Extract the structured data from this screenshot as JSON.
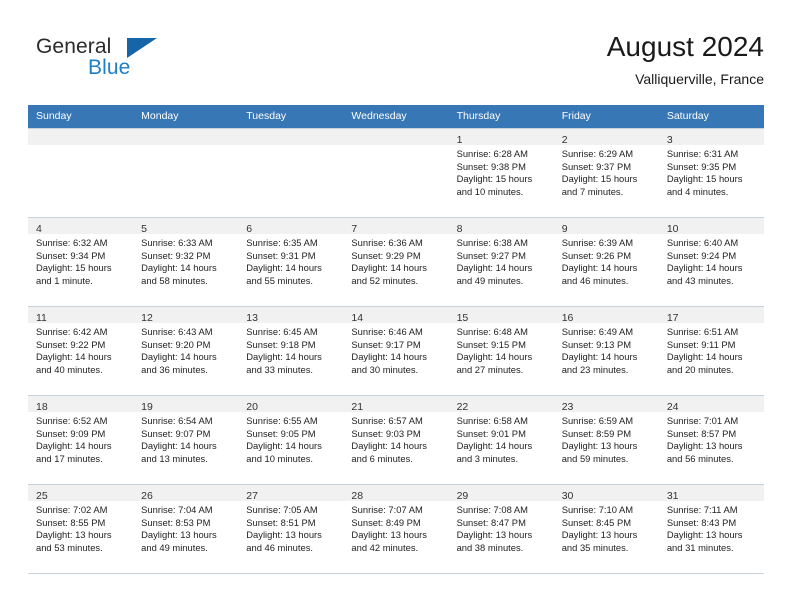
{
  "brand": {
    "word_one": "General",
    "word_two": "Blue",
    "triangle_color": "#1565a8",
    "blue_color": "#1f7fc4"
  },
  "header": {
    "title": "August 2024",
    "subtitle": "Valliquerville, France"
  },
  "theme": {
    "header_row_bg": "#3877b5",
    "daynum_band_bg": "#f1f1f1",
    "grid_line": "#c8d2dc"
  },
  "weekday_headers": [
    "Sunday",
    "Monday",
    "Tuesday",
    "Wednesday",
    "Thursday",
    "Friday",
    "Saturday"
  ],
  "weeks": [
    [
      {
        "day": "",
        "sunrise": "",
        "sunset": "",
        "daylight_1": "",
        "daylight_2": "",
        "empty": true
      },
      {
        "day": "",
        "sunrise": "",
        "sunset": "",
        "daylight_1": "",
        "daylight_2": "",
        "empty": true
      },
      {
        "day": "",
        "sunrise": "",
        "sunset": "",
        "daylight_1": "",
        "daylight_2": "",
        "empty": true
      },
      {
        "day": "",
        "sunrise": "",
        "sunset": "",
        "daylight_1": "",
        "daylight_2": "",
        "empty": true
      },
      {
        "day": "1",
        "sunrise": "Sunrise: 6:28 AM",
        "sunset": "Sunset: 9:38 PM",
        "daylight_1": "Daylight: 15 hours",
        "daylight_2": "and 10 minutes."
      },
      {
        "day": "2",
        "sunrise": "Sunrise: 6:29 AM",
        "sunset": "Sunset: 9:37 PM",
        "daylight_1": "Daylight: 15 hours",
        "daylight_2": "and 7 minutes."
      },
      {
        "day": "3",
        "sunrise": "Sunrise: 6:31 AM",
        "sunset": "Sunset: 9:35 PM",
        "daylight_1": "Daylight: 15 hours",
        "daylight_2": "and 4 minutes."
      }
    ],
    [
      {
        "day": "4",
        "sunrise": "Sunrise: 6:32 AM",
        "sunset": "Sunset: 9:34 PM",
        "daylight_1": "Daylight: 15 hours",
        "daylight_2": "and 1 minute."
      },
      {
        "day": "5",
        "sunrise": "Sunrise: 6:33 AM",
        "sunset": "Sunset: 9:32 PM",
        "daylight_1": "Daylight: 14 hours",
        "daylight_2": "and 58 minutes."
      },
      {
        "day": "6",
        "sunrise": "Sunrise: 6:35 AM",
        "sunset": "Sunset: 9:31 PM",
        "daylight_1": "Daylight: 14 hours",
        "daylight_2": "and 55 minutes."
      },
      {
        "day": "7",
        "sunrise": "Sunrise: 6:36 AM",
        "sunset": "Sunset: 9:29 PM",
        "daylight_1": "Daylight: 14 hours",
        "daylight_2": "and 52 minutes."
      },
      {
        "day": "8",
        "sunrise": "Sunrise: 6:38 AM",
        "sunset": "Sunset: 9:27 PM",
        "daylight_1": "Daylight: 14 hours",
        "daylight_2": "and 49 minutes."
      },
      {
        "day": "9",
        "sunrise": "Sunrise: 6:39 AM",
        "sunset": "Sunset: 9:26 PM",
        "daylight_1": "Daylight: 14 hours",
        "daylight_2": "and 46 minutes."
      },
      {
        "day": "10",
        "sunrise": "Sunrise: 6:40 AM",
        "sunset": "Sunset: 9:24 PM",
        "daylight_1": "Daylight: 14 hours",
        "daylight_2": "and 43 minutes."
      }
    ],
    [
      {
        "day": "11",
        "sunrise": "Sunrise: 6:42 AM",
        "sunset": "Sunset: 9:22 PM",
        "daylight_1": "Daylight: 14 hours",
        "daylight_2": "and 40 minutes."
      },
      {
        "day": "12",
        "sunrise": "Sunrise: 6:43 AM",
        "sunset": "Sunset: 9:20 PM",
        "daylight_1": "Daylight: 14 hours",
        "daylight_2": "and 36 minutes."
      },
      {
        "day": "13",
        "sunrise": "Sunrise: 6:45 AM",
        "sunset": "Sunset: 9:18 PM",
        "daylight_1": "Daylight: 14 hours",
        "daylight_2": "and 33 minutes."
      },
      {
        "day": "14",
        "sunrise": "Sunrise: 6:46 AM",
        "sunset": "Sunset: 9:17 PM",
        "daylight_1": "Daylight: 14 hours",
        "daylight_2": "and 30 minutes."
      },
      {
        "day": "15",
        "sunrise": "Sunrise: 6:48 AM",
        "sunset": "Sunset: 9:15 PM",
        "daylight_1": "Daylight: 14 hours",
        "daylight_2": "and 27 minutes."
      },
      {
        "day": "16",
        "sunrise": "Sunrise: 6:49 AM",
        "sunset": "Sunset: 9:13 PM",
        "daylight_1": "Daylight: 14 hours",
        "daylight_2": "and 23 minutes."
      },
      {
        "day": "17",
        "sunrise": "Sunrise: 6:51 AM",
        "sunset": "Sunset: 9:11 PM",
        "daylight_1": "Daylight: 14 hours",
        "daylight_2": "and 20 minutes."
      }
    ],
    [
      {
        "day": "18",
        "sunrise": "Sunrise: 6:52 AM",
        "sunset": "Sunset: 9:09 PM",
        "daylight_1": "Daylight: 14 hours",
        "daylight_2": "and 17 minutes."
      },
      {
        "day": "19",
        "sunrise": "Sunrise: 6:54 AM",
        "sunset": "Sunset: 9:07 PM",
        "daylight_1": "Daylight: 14 hours",
        "daylight_2": "and 13 minutes."
      },
      {
        "day": "20",
        "sunrise": "Sunrise: 6:55 AM",
        "sunset": "Sunset: 9:05 PM",
        "daylight_1": "Daylight: 14 hours",
        "daylight_2": "and 10 minutes."
      },
      {
        "day": "21",
        "sunrise": "Sunrise: 6:57 AM",
        "sunset": "Sunset: 9:03 PM",
        "daylight_1": "Daylight: 14 hours",
        "daylight_2": "and 6 minutes."
      },
      {
        "day": "22",
        "sunrise": "Sunrise: 6:58 AM",
        "sunset": "Sunset: 9:01 PM",
        "daylight_1": "Daylight: 14 hours",
        "daylight_2": "and 3 minutes."
      },
      {
        "day": "23",
        "sunrise": "Sunrise: 6:59 AM",
        "sunset": "Sunset: 8:59 PM",
        "daylight_1": "Daylight: 13 hours",
        "daylight_2": "and 59 minutes."
      },
      {
        "day": "24",
        "sunrise": "Sunrise: 7:01 AM",
        "sunset": "Sunset: 8:57 PM",
        "daylight_1": "Daylight: 13 hours",
        "daylight_2": "and 56 minutes."
      }
    ],
    [
      {
        "day": "25",
        "sunrise": "Sunrise: 7:02 AM",
        "sunset": "Sunset: 8:55 PM",
        "daylight_1": "Daylight: 13 hours",
        "daylight_2": "and 53 minutes."
      },
      {
        "day": "26",
        "sunrise": "Sunrise: 7:04 AM",
        "sunset": "Sunset: 8:53 PM",
        "daylight_1": "Daylight: 13 hours",
        "daylight_2": "and 49 minutes."
      },
      {
        "day": "27",
        "sunrise": "Sunrise: 7:05 AM",
        "sunset": "Sunset: 8:51 PM",
        "daylight_1": "Daylight: 13 hours",
        "daylight_2": "and 46 minutes."
      },
      {
        "day": "28",
        "sunrise": "Sunrise: 7:07 AM",
        "sunset": "Sunset: 8:49 PM",
        "daylight_1": "Daylight: 13 hours",
        "daylight_2": "and 42 minutes."
      },
      {
        "day": "29",
        "sunrise": "Sunrise: 7:08 AM",
        "sunset": "Sunset: 8:47 PM",
        "daylight_1": "Daylight: 13 hours",
        "daylight_2": "and 38 minutes."
      },
      {
        "day": "30",
        "sunrise": "Sunrise: 7:10 AM",
        "sunset": "Sunset: 8:45 PM",
        "daylight_1": "Daylight: 13 hours",
        "daylight_2": "and 35 minutes."
      },
      {
        "day": "31",
        "sunrise": "Sunrise: 7:11 AM",
        "sunset": "Sunset: 8:43 PM",
        "daylight_1": "Daylight: 13 hours",
        "daylight_2": "and 31 minutes."
      }
    ]
  ]
}
